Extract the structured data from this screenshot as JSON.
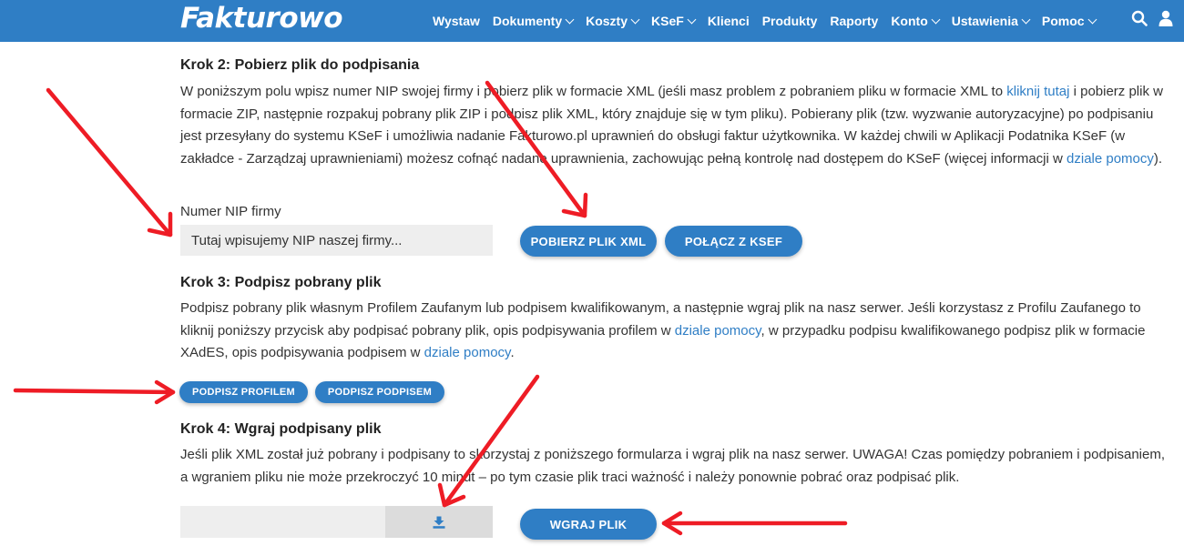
{
  "brand": {
    "logo": "Fakturowo",
    "color": "#2f7ec5"
  },
  "nav": {
    "items": [
      {
        "label": "Wystaw",
        "dropdown": false
      },
      {
        "label": "Dokumenty",
        "dropdown": true
      },
      {
        "label": "Koszty",
        "dropdown": true
      },
      {
        "label": "KSeF",
        "dropdown": true
      },
      {
        "label": "Klienci",
        "dropdown": false
      },
      {
        "label": "Produkty",
        "dropdown": false
      },
      {
        "label": "Raporty",
        "dropdown": false
      },
      {
        "label": "Konto",
        "dropdown": true
      },
      {
        "label": "Ustawienia",
        "dropdown": true
      },
      {
        "label": "Pomoc",
        "dropdown": true
      }
    ],
    "icons": [
      "search-icon",
      "user-icon"
    ]
  },
  "step2": {
    "title": "Krok 2: Pobierz plik do podpisania",
    "text_1": "W poniższym polu wpisz numer NIP swojej firmy i pobierz plik w formacie XML (jeśli masz problem z pobraniem pliku w formacie XML to ",
    "link_1": "kliknij tutaj",
    "text_2": " i pobierz plik w formacie ZIP, następnie rozpakuj pobrany plik ZIP i podpisz plik XML, który znajduje się w tym pliku). Pobierany plik (tzw. wyzwanie autoryzacyjne) po podpisaniu jest przesyłany do systemu KSeF i umożliwia nadanie Fakturowo.pl uprawnień do obsługi faktur użytkownika. W każdej chwili w Aplikacji Podatnika KSeF (w zakładce - Zarządzaj uprawnieniami) możesz cofnąć nadane uprawnienia, zachowując pełną kontrolę nad dostępem do KSeF (więcej informacji w ",
    "link_2": "dziale pomocy",
    "text_3": ").",
    "nip_label": "Numer NIP firmy",
    "nip_value": "Tutaj wpisujemy NIP naszej firmy...",
    "btn_download": "POBIERZ PLIK XML",
    "btn_connect": "POŁĄCZ Z KSEF"
  },
  "step3": {
    "title": "Krok 3: Podpisz pobrany plik",
    "text_1": "Podpisz pobrany plik własnym Profilem Zaufanym lub podpisem kwalifikowanym, a następnie wgraj plik na nasz serwer. Jeśli korzystasz z Profilu Zaufanego to kliknij poniższy przycisk aby podpisać pobrany plik, opis podpisywania profilem w ",
    "link_1": "dziale pomocy",
    "text_2": ", w przypadku podpisu kwalifikowanego podpisz plik w formacie XAdES, opis podpisywania podpisem w ",
    "link_2": "dziale pomocy",
    "text_3": ".",
    "btn_profile": "PODPISZ PROFILEM",
    "btn_signature": "PODPISZ PODPISEM"
  },
  "step4": {
    "title": "Krok 4: Wgraj podpisany plik",
    "text": "Jeśli plik XML został już pobrany i podpisany to skorzystaj z poniższego formularza i wgraj plik na nasz serwer. UWAGA! Czas pomiędzy pobraniem i podpisaniem, a wgraniem pliku nie może przekroczyć 10 minut – po tym czasie plik traci ważność i należy ponownie pobrać oraz podpisać plik.",
    "file_icon": "upload-icon",
    "btn_upload": "WGRAJ PLIK"
  },
  "annotation": {
    "arrow_color": "#ee1c25"
  }
}
